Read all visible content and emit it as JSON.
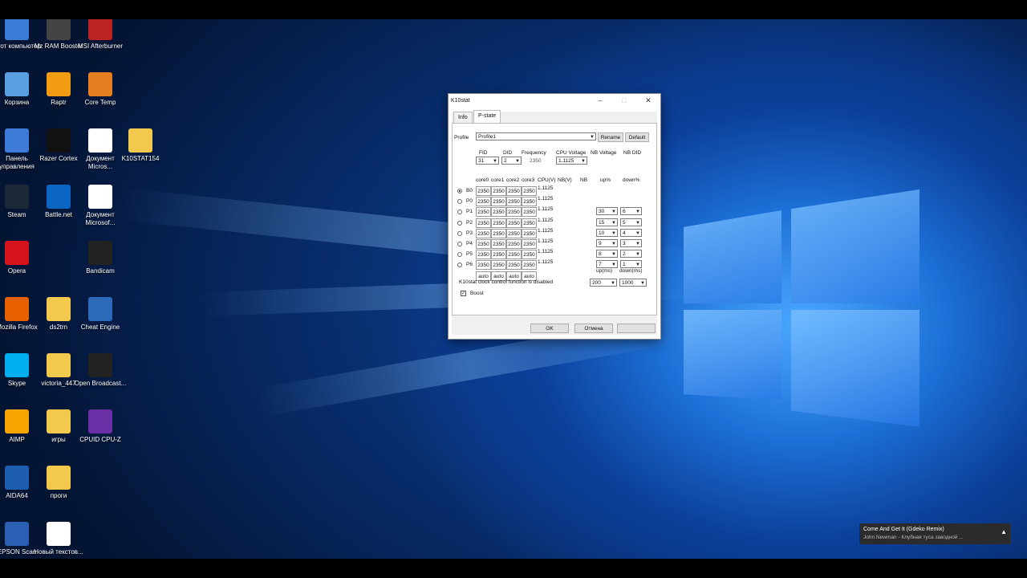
{
  "desktop_icons": [
    {
      "label": "Этот компьютер",
      "icon": "computer-icon"
    },
    {
      "label": "Mz RAM Booster",
      "icon": "ram-booster-icon"
    },
    {
      "label": "MSI Afterburner",
      "icon": "afterburner-icon"
    },
    {
      "label": "Корзина",
      "icon": "recycle-bin-icon"
    },
    {
      "label": "Raptr",
      "icon": "raptr-icon"
    },
    {
      "label": "Core Temp",
      "icon": "thermometer-icon"
    },
    {
      "label": "Панель управления",
      "icon": "control-panel-icon"
    },
    {
      "label": "Razer Cortex",
      "icon": "razer-icon"
    },
    {
      "label": "Документ Micros...",
      "icon": "pdf-icon"
    },
    {
      "label": "K10STAT154",
      "icon": "folder-icon"
    },
    {
      "label": "Steam",
      "icon": "steam-icon"
    },
    {
      "label": "Battle.net",
      "icon": "battlenet-icon"
    },
    {
      "label": "Документ Microsof...",
      "icon": "word-doc-icon"
    },
    {
      "label": "Opera",
      "icon": "opera-icon"
    },
    {
      "label": "Bandicam",
      "icon": "bandicam-icon"
    },
    {
      "label": "Mozilla Firefox",
      "icon": "firefox-icon"
    },
    {
      "label": "ds2trn",
      "icon": "folder-icon"
    },
    {
      "label": "Cheat Engine",
      "icon": "cheat-engine-icon"
    },
    {
      "label": "Skype",
      "icon": "skype-icon"
    },
    {
      "label": "victoria_447",
      "icon": "folder-icon"
    },
    {
      "label": "Open Broadcast...",
      "icon": "obs-icon"
    },
    {
      "label": "AIMP",
      "icon": "aimp-icon"
    },
    {
      "label": "игры",
      "icon": "folder-icon"
    },
    {
      "label": "CPUID CPU-Z",
      "icon": "cpuz-icon"
    },
    {
      "label": "AIDA64",
      "icon": "aida64-icon"
    },
    {
      "label": "проги",
      "icon": "folder-icon"
    },
    {
      "label": "EPSON Scan",
      "icon": "scanner-icon"
    },
    {
      "label": "Новый текстов...",
      "icon": "text-file-icon"
    }
  ],
  "window": {
    "title": "K10stat",
    "tabs": [
      {
        "label": "Info"
      },
      {
        "label": "P-state"
      }
    ],
    "profile_label": "Profile",
    "profile_value": "Profile1",
    "rename_label": "Rename",
    "default_label": "Default",
    "headers": {
      "fid": "FID",
      "did": "DID",
      "frequency": "Frequency",
      "cpu_voltage": "CPU Voltage",
      "nb_voltage": "NB Voltage",
      "nb_did": "NB DID"
    },
    "fid_value": "31",
    "did_value": "2",
    "frequency_value": "2350",
    "cpu_voltage_value": "1.1125",
    "grid_headers": [
      "core0",
      "core1",
      "core2",
      "core3",
      "CPU(V)",
      "NB(V)",
      "NB",
      "up%",
      "down%"
    ],
    "pstates": [
      {
        "name": "B0",
        "cores": [
          "2350",
          "2350",
          "2350",
          "2350"
        ],
        "cpu_v": "1.1125",
        "up": "",
        "down": "",
        "selected": true
      },
      {
        "name": "P0",
        "cores": [
          "2350",
          "2350",
          "2350",
          "2350"
        ],
        "cpu_v": "1.1125",
        "up": "",
        "down": ""
      },
      {
        "name": "P1",
        "cores": [
          "2350",
          "2350",
          "2350",
          "2350"
        ],
        "cpu_v": "1.1125",
        "up": "30",
        "down": "6"
      },
      {
        "name": "P2",
        "cores": [
          "2350",
          "2350",
          "2350",
          "2350"
        ],
        "cpu_v": "1.1125",
        "up": "15",
        "down": "5"
      },
      {
        "name": "P3",
        "cores": [
          "2350",
          "2350",
          "2350",
          "2350"
        ],
        "cpu_v": "1.1125",
        "up": "10",
        "down": "4"
      },
      {
        "name": "P4",
        "cores": [
          "2350",
          "2350",
          "2350",
          "2350"
        ],
        "cpu_v": "1.1125",
        "up": "9",
        "down": "3"
      },
      {
        "name": "P5",
        "cores": [
          "2350",
          "2350",
          "2350",
          "2350"
        ],
        "cpu_v": "1.1125",
        "up": "8",
        "down": "2"
      },
      {
        "name": "P6",
        "cores": [
          "2350",
          "2350",
          "2350",
          "2350"
        ],
        "cpu_v": "1.1125",
        "up": "7",
        "down": "1"
      }
    ],
    "auto_values": [
      "auto",
      "auto",
      "auto",
      "auto"
    ],
    "up_ms_label": "up(ms)",
    "down_ms_label": "down(ms)",
    "up_ms_value": "200",
    "down_ms_value": "1000",
    "status_text": "K10stat clock control function is disabled",
    "boost_label": "Boost",
    "ok_label": "OK",
    "cancel_label": "Отмена"
  },
  "toast": {
    "title": "Come And Get It (Gdeko Remix)",
    "subtitle": "John Newman - Клубная туса заводной ..."
  }
}
